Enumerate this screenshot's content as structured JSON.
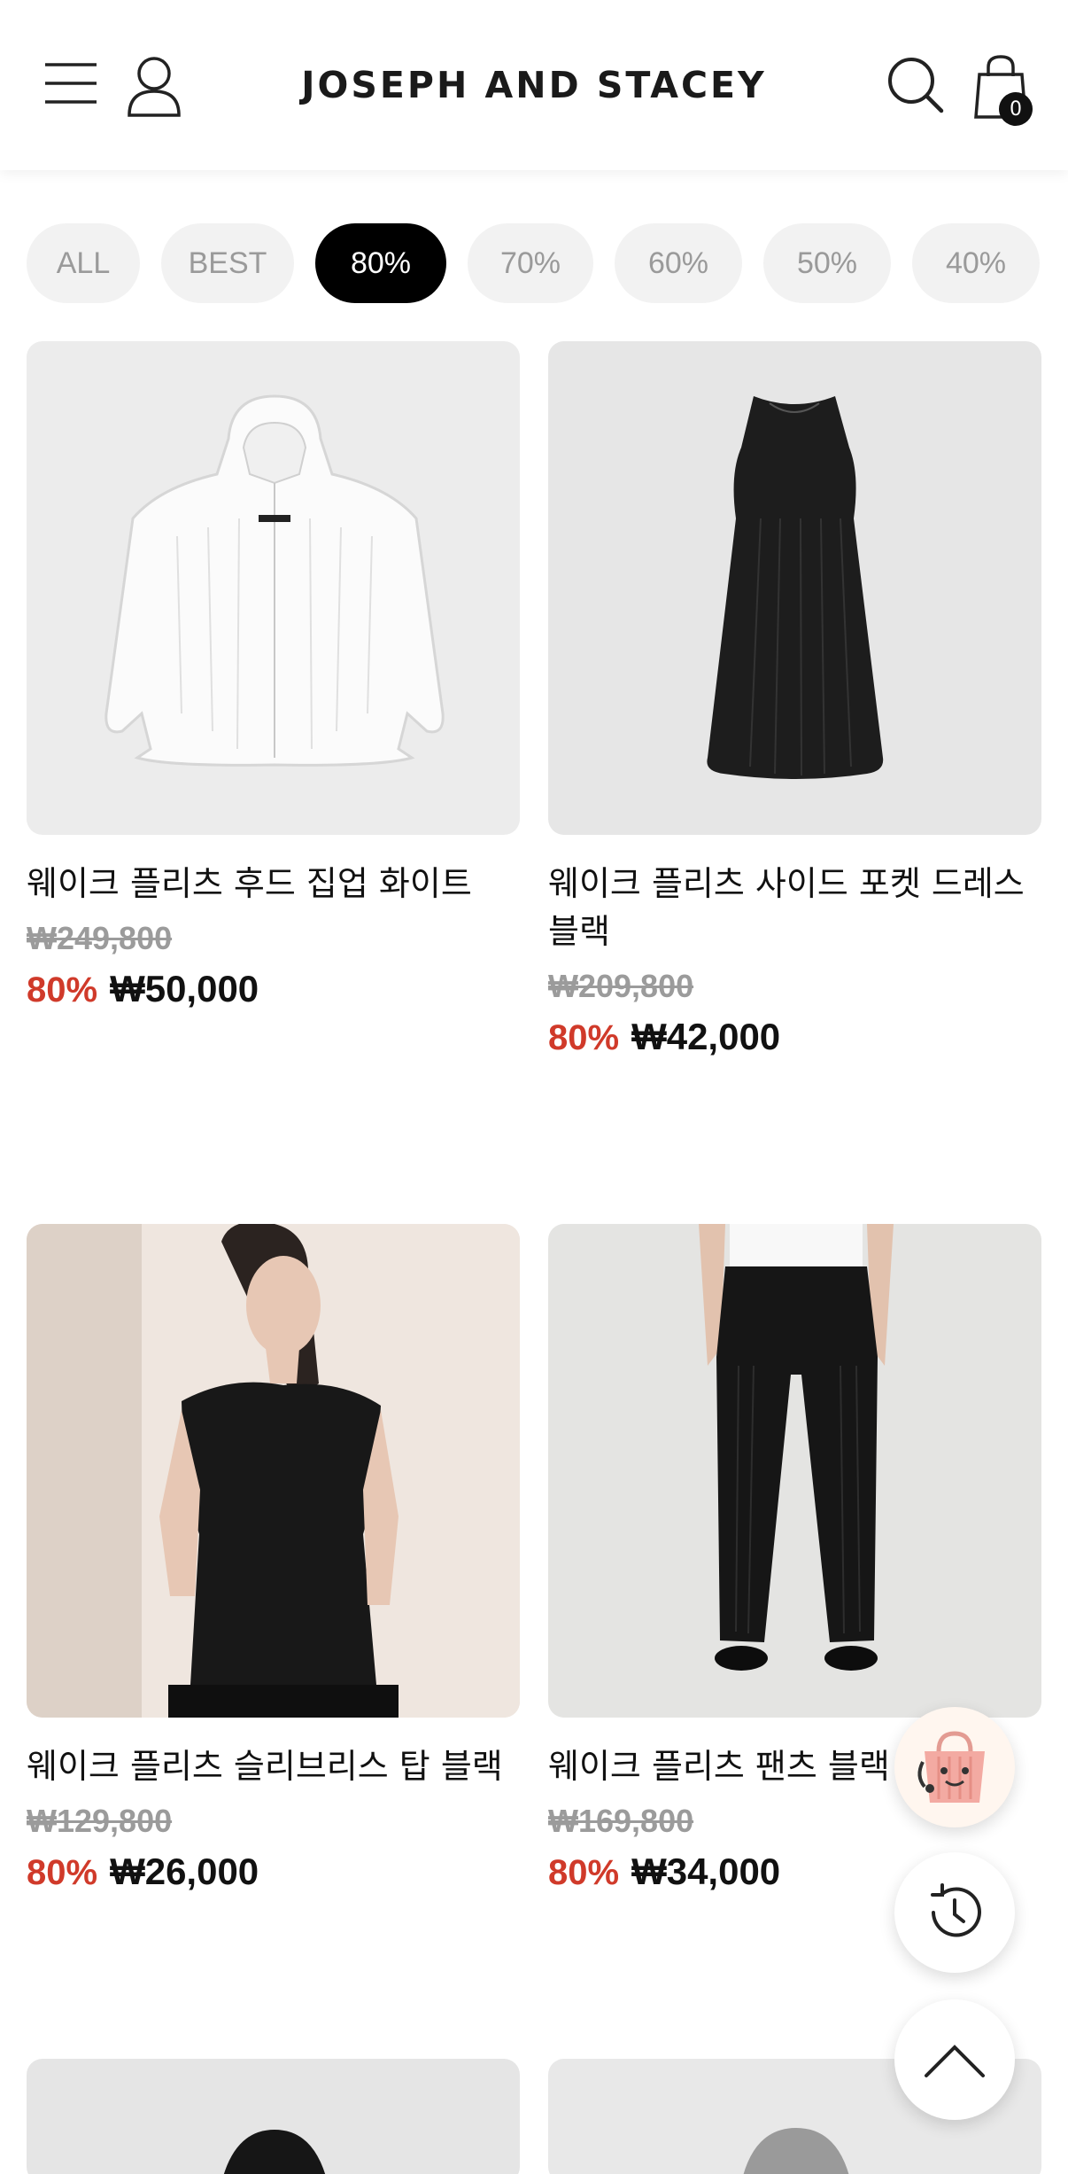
{
  "header": {
    "brand": "JOSEPH AND STACEY",
    "cart_count": "0",
    "icons": [
      "menu-icon",
      "user-icon",
      "search-icon",
      "shopping-bag-icon"
    ]
  },
  "filters": [
    {
      "label": "ALL",
      "active": false
    },
    {
      "label": "BEST",
      "active": false
    },
    {
      "label": "80%",
      "active": true
    },
    {
      "label": "70%",
      "active": false
    },
    {
      "label": "60%",
      "active": false
    },
    {
      "label": "50%",
      "active": false
    },
    {
      "label": "40%",
      "active": false
    }
  ],
  "products": [
    {
      "name": "웨이크 플리츠 후드 집업 화이트",
      "original_price": "₩249,800",
      "discount": "80%",
      "price": "₩50,000",
      "image": "white-hooded-zip-up-jacket"
    },
    {
      "name": "웨이크 플리츠 사이드 포켓 드레스 블랙",
      "original_price": "₩209,800",
      "discount": "80%",
      "price": "₩42,000",
      "image": "black-sleeveless-dress"
    },
    {
      "name": "웨이크 플리츠 슬리브리스 탑 블랙",
      "original_price": "₩129,800",
      "discount": "80%",
      "price": "₩26,000",
      "image": "model-black-sleeveless-top"
    },
    {
      "name": "웨이크 플리츠 팬츠 블랙",
      "original_price": "₩169,800",
      "discount": "80%",
      "price": "₩34,000",
      "image": "model-black-pleated-pants"
    },
    {
      "name": "",
      "original_price": "",
      "discount": "",
      "price": "",
      "image": "black-hood-partial"
    },
    {
      "name": "",
      "original_price": "",
      "discount": "",
      "price": "",
      "image": "gray-hood-partial"
    }
  ],
  "floating": {
    "icons": [
      "shopping-assistant-icon",
      "recent-history-icon",
      "chevron-up-icon"
    ]
  },
  "colors": {
    "discount": "#d03a2a",
    "active_chip": "#000000",
    "chip_bg": "#f2f2f2"
  }
}
